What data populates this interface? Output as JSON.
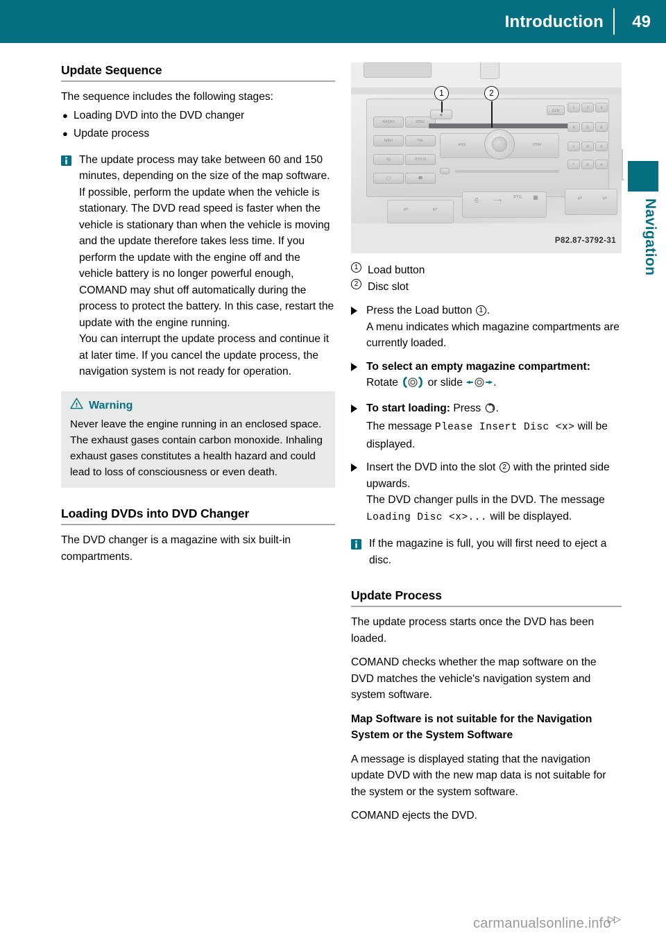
{
  "colors": {
    "accent": "#056e80",
    "warning_bg": "#e8e9e9",
    "rule": "#a8a8a8",
    "watermark": "#9a9a9a"
  },
  "header": {
    "title": "Introduction",
    "page_number": "49"
  },
  "side_tab": {
    "label": "Navigation"
  },
  "left_column": {
    "heading": "Update Sequence",
    "intro": "The sequence includes the following stages:",
    "bullets": [
      "Loading DVD into the DVD changer",
      "Update process"
    ],
    "note": {
      "icon": "info-icon",
      "paragraphs": [
        "The update process may take between 60 and 150 minutes, depending on the size of the map software.",
        "If possible, perform the update when the vehicle is stationary. The DVD read speed is faster when the vehicle is stationary than when the vehicle is moving and the update therefore takes less time. If you perform the update with the engine off and the vehicle battery is no longer powerful enough, COMAND may shut off automatically during the process to protect the battery. In this case, restart the update with the engine running.",
        "You can interrupt the update process and continue it at later time. If you cancel the update process, the navigation system is not ready for operation."
      ]
    },
    "warning": {
      "icon": "warning-triangle-icon",
      "title": "Warning",
      "text": "Never leave the engine running in an enclosed space. The exhaust gases contain carbon monoxide. Inhaling exhaust gases constitutes a health hazard and could lead to loss of consciousness or even death."
    },
    "heading2": "Loading DVDs into DVD Changer",
    "body2": "The DVD changer is a magazine with six built-in compartments."
  },
  "right_column": {
    "figure": {
      "alt": "COMAND centre console with load button and disc slot",
      "image_code": "P82.87-3792-31",
      "callouts": [
        {
          "number": "1"
        },
        {
          "number": "2"
        }
      ],
      "button_labels": [
        "RADIO",
        "DISC",
        "NAVI",
        "TEL",
        "IQ",
        "SYS D",
        "CLR",
        "1",
        "2",
        "3",
        "4",
        "5",
        "6",
        "7",
        "8",
        "9",
        "*",
        "0",
        "#",
        "ASG",
        "ON",
        "DSN"
      ]
    },
    "legend": [
      {
        "number": "1",
        "label": "Load button"
      },
      {
        "number": "2",
        "label": "Disc slot"
      }
    ],
    "steps": [
      {
        "lead_plain": "Press the Load button ",
        "lead_ref": "1",
        "lead_tail": ".",
        "follow": "A menu indicates which magazine compartments are currently loaded."
      },
      {
        "bold": "To select an empty magazine compartment:",
        "plain_a": " Rotate ",
        "symbol_a": "comand-rotate-icon",
        "plain_b": " or slide ",
        "symbol_b": "comand-slide-icon",
        "plain_c": "."
      },
      {
        "bold": "To start loading:",
        "plain_a": " Press ",
        "symbol_a": "comand-press-icon",
        "plain_c": ".",
        "follow_pre": "The message ",
        "follow_mono": "Please Insert Disc <x>",
        "follow_post": " will be displayed."
      },
      {
        "lead_plain": "Insert the DVD into the slot ",
        "lead_ref": "2",
        "lead_tail": " with the printed side upwards.",
        "follow_pre": "The DVD changer pulls in the DVD. The message ",
        "follow_mono": "Loading Disc <x>...",
        "follow_post": " will be displayed."
      }
    ],
    "note": {
      "icon": "info-icon",
      "text": "If the magazine is full, you will first need to eject a disc."
    },
    "heading2": "Update Process",
    "body_paragraphs": [
      "The update process starts once the DVD has been loaded.",
      "COMAND checks whether the map software on the DVD matches the vehicle's navigation system and system software."
    ],
    "subheading": "Map Software is not suitable for the Navigation System or the System Software",
    "body_paragraphs2": [
      "A message is displayed stating that the navigation update DVD with the new map data is not suitable for the system or the system software.",
      "COMAND ejects the DVD."
    ]
  },
  "watermark": {
    "text": "carmanualsonline.info",
    "arrows": "▷▷"
  }
}
